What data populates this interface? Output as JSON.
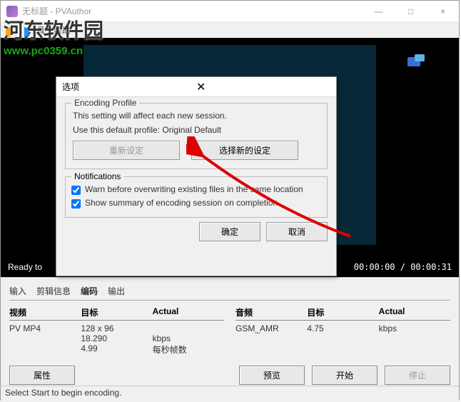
{
  "window": {
    "title": "无标题 - PVAuthor",
    "sysbuttons": {
      "min": "—",
      "max": "□",
      "close": "×"
    }
  },
  "watermark": {
    "text": "河东软件园",
    "url": "www.pc0359.cn"
  },
  "menubar": {
    "item1": "具",
    "item2": "帮助"
  },
  "status": {
    "ready": "Ready to",
    "time": "00:00:00 / 00:00:31"
  },
  "dialog": {
    "title": "选项",
    "close": "✕",
    "group_encoding": "Encoding Profile",
    "enc_line1": "This setting will affect each new session.",
    "enc_line2": "Use this default profile: Original Default",
    "btn_reset": "重新设定",
    "btn_select": "选择新的设定",
    "group_notif": "Notifications",
    "chk1": "Warn before overwriting existing files in the same location",
    "chk2": "Show summary of encoding session on completion.",
    "btn_ok": "确定",
    "btn_cancel": "取消"
  },
  "tabs": {
    "t1": "输入",
    "t2": "剪辑信息",
    "t3": "编码",
    "t4": "输出"
  },
  "video_info": {
    "head": {
      "c1": "视频",
      "c2": "目标",
      "c3": "Actual"
    },
    "r1": {
      "c1": "PV MP4",
      "c2": "128 x 96",
      "c3": ""
    },
    "r2": {
      "c1": "",
      "c2": "18.290",
      "c3": "kbps"
    },
    "r3": {
      "c1": "",
      "c2": "4.99",
      "c3": "每秒帧数"
    }
  },
  "audio_info": {
    "head": {
      "c1": "音频",
      "c2": "目标",
      "c3": "Actual"
    },
    "r1": {
      "c1": "GSM_AMR",
      "c2": "4.75",
      "c3": "kbps"
    }
  },
  "buttons": {
    "props": "属性",
    "preview": "预览",
    "start": "开始",
    "stop": "停止"
  },
  "bottomstatus": "Select Start to begin encoding."
}
